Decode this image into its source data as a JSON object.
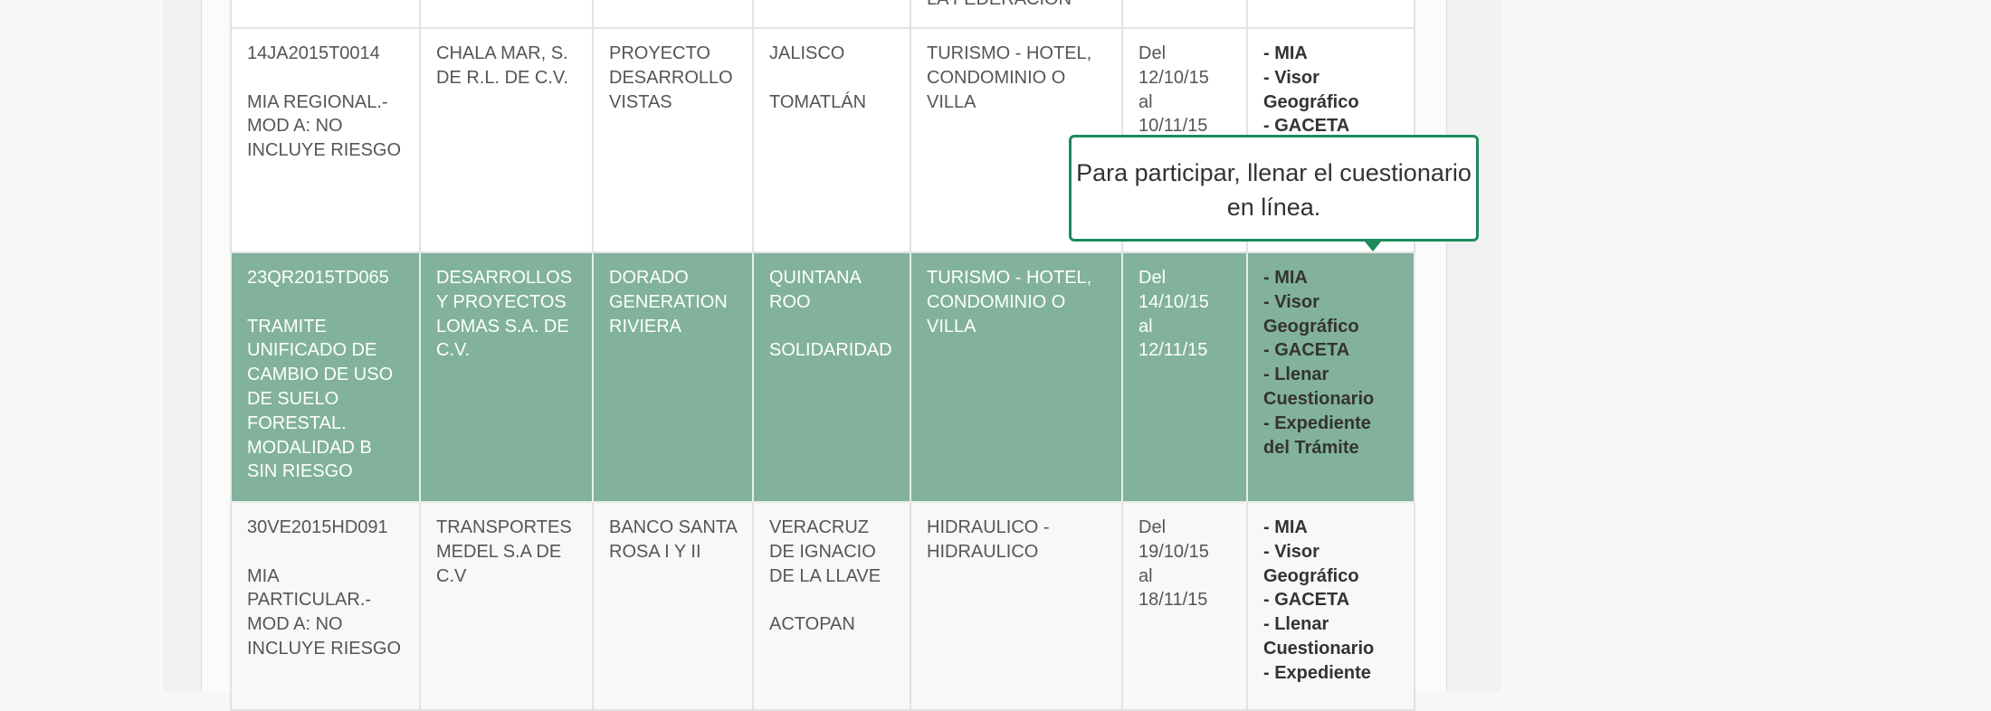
{
  "rows": [
    {
      "style": "white",
      "clave": "",
      "promovente": "",
      "proyecto": "",
      "entidad": "",
      "municipio": "",
      "sector": "LA FEDERACION",
      "periodo": "",
      "links": []
    },
    {
      "style": "white",
      "clave": "14JA2015T0014",
      "tipo": "MIA REGIONAL.-MOD A: NO INCLUYE RIESGO",
      "promovente": "CHALA MAR, S. DE R.L. DE C.V.",
      "proyecto": "PROYECTO DESARROLLO VISTAS",
      "entidad": "JALISCO",
      "municipio": "TOMATLÁN",
      "sector": "TURISMO - HOTEL, CONDOMINIO O VILLA",
      "periodo": [
        "Del",
        "12/10/15",
        "al",
        "10/11/15"
      ],
      "links": [
        "- MIA",
        "- Visor Geográfico",
        "- GACETA"
      ]
    },
    {
      "style": "hl",
      "clave": "23QR2015TD065",
      "tipo": "TRAMITE UNIFICADO DE CAMBIO DE USO DE SUELO FORESTAL. MODALIDAD B SIN RIESGO",
      "promovente": "DESARROLLOS Y PROYECTOS LOMAS S.A. DE C.V.",
      "proyecto": "DORADO GENERATION RIVIERA",
      "entidad": "QUINTANA ROO",
      "municipio": "SOLIDARIDAD",
      "sector": "TURISMO - HOTEL, CONDOMINIO O VILLA",
      "periodo": [
        "Del",
        "14/10/15",
        "al",
        "12/11/15"
      ],
      "links": [
        "- MIA",
        "- Visor Geográfico",
        "- GACETA",
        "- Llenar Cuestionario",
        "- Expediente del Trámite"
      ]
    },
    {
      "style": "gray",
      "clave": "30VE2015HD091",
      "tipo": "MIA PARTICULAR.-MOD A: NO INCLUYE RIESGO",
      "promovente": "TRANSPORTES MEDEL S.A DE C.V",
      "proyecto": "BANCO SANTA ROSA I Y II",
      "entidad": "VERACRUZ DE IGNACIO DE LA LLAVE",
      "municipio": "ACTOPAN",
      "sector": "HIDRAULICO - HIDRAULICO",
      "periodo": [
        "Del",
        "19/10/15",
        "al",
        "18/11/15"
      ],
      "links": [
        "- MIA",
        "- Visor Geográfico",
        "- GACETA",
        "- Llenar Cuestionario",
        "- Expediente"
      ]
    }
  ],
  "tooltip": {
    "text": "Para participar, llenar el cuestionario en línea."
  },
  "colors": {
    "highlight_row": "#82b29c",
    "tooltip_border": "#1d8a5a"
  }
}
